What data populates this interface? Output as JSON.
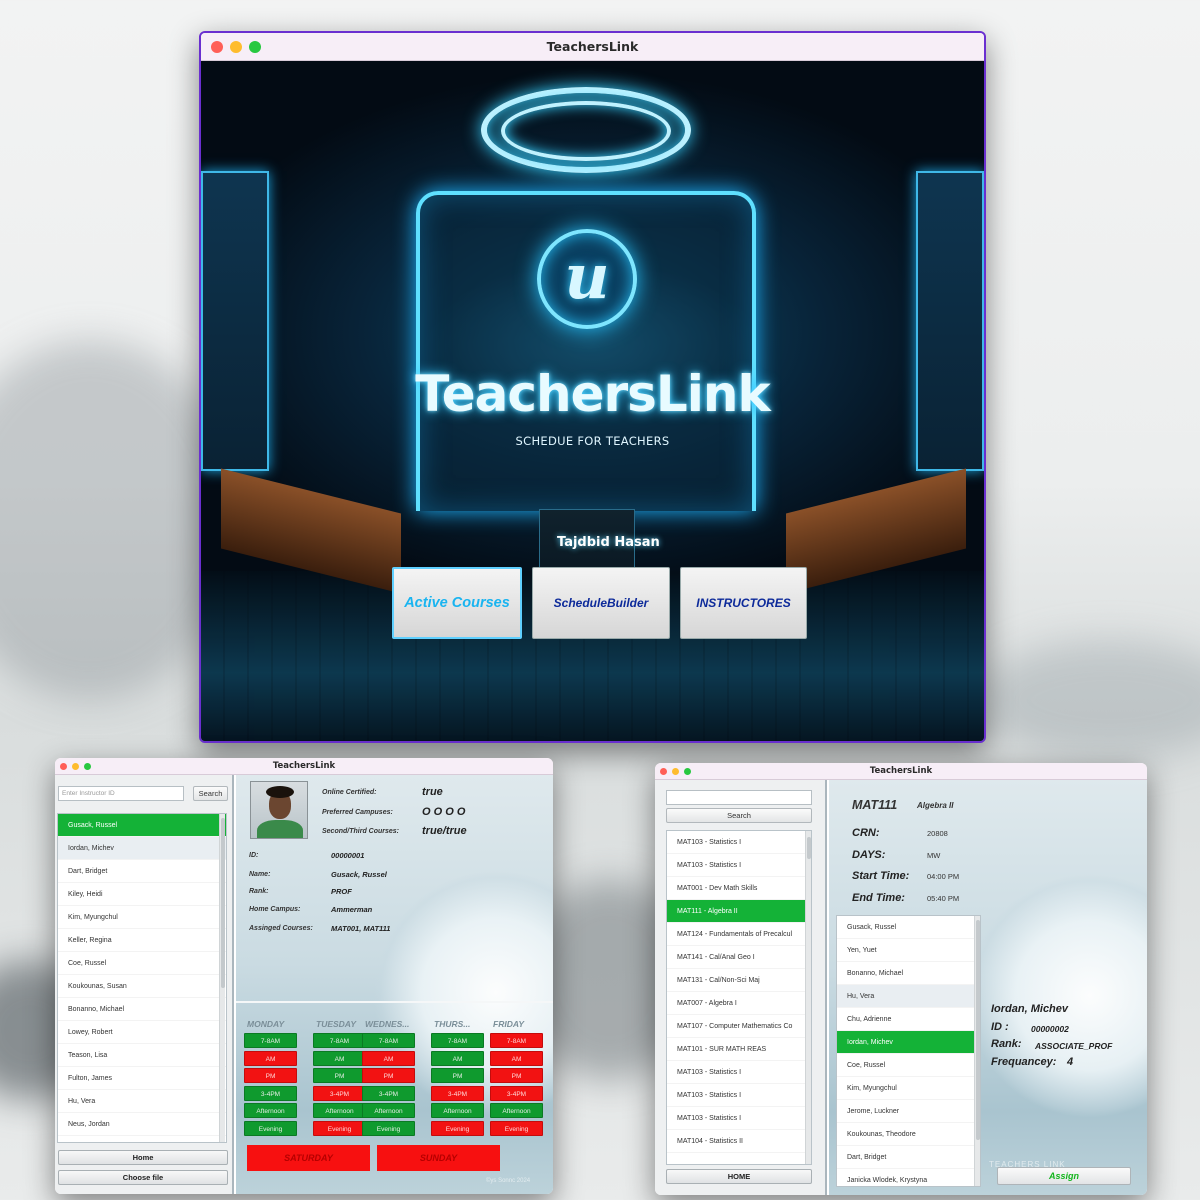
{
  "main_window": {
    "title": "TeachersLink",
    "hero": {
      "logo_letter": "u",
      "app_name": "TeachersLink",
      "tagline": "SCHEDUE FOR TEACHERS",
      "author": "Tajdbid Hasan"
    },
    "buttons": {
      "active_courses": "Active Courses",
      "schedule_builder": "ScheduleBuilder",
      "instructors": "INSTRUCTORES"
    }
  },
  "instructor_window": {
    "title": "TeachersLink",
    "search_placeholder": "Enter Instructor ID",
    "search_button": "Search",
    "instructors": [
      "Gusack, Russel",
      "Iordan, Michev",
      "Dart, Bridget",
      "Kiley, Heidi",
      "Kim, Myungchul",
      "Keller, Regina",
      "Coe, Russel",
      "Koukounas, Susan",
      "Bonanno, Michael",
      "Lowey, Robert",
      "Teason, Lisa",
      "Fulton, James",
      "Hu, Vera",
      "Neus, Jordan"
    ],
    "selected_index": 0,
    "home_button": "Home",
    "choose_file_button": "Choose file",
    "details": {
      "online_certified_label": "Online Certified:",
      "online_certified_value": "true",
      "preferred_campuses_label": "Preferred Campuses:",
      "preferred_campuses_value": "O O O O",
      "second_third_label": "Second/Third Courses:",
      "second_third_value": "true/true",
      "id_label": "ID:",
      "id_value": "00000001",
      "name_label": "Name:",
      "name_value": "Gusack, Russel",
      "rank_label": "Rank:",
      "rank_value": "PROF",
      "home_campus_label": "Home Campus:",
      "home_campus_value": "Ammerman",
      "assigned_courses_label": "Assinged Courses:",
      "assigned_courses_value": "MAT001, MAT111"
    },
    "schedule": {
      "days": [
        "MONDAY",
        "TUESDAY",
        "WEDNES...",
        "THURS...",
        "FRIDAY"
      ],
      "slot_labels": [
        "7-8AM",
        "AM",
        "PM",
        "3-4PM",
        "Afternoon",
        "Evening"
      ],
      "availability": [
        [
          "available",
          "available",
          "available",
          "available",
          "unavailable"
        ],
        [
          "unavailable",
          "available",
          "unavailable",
          "available",
          "unavailable"
        ],
        [
          "unavailable",
          "available",
          "unavailable",
          "available",
          "unavailable"
        ],
        [
          "available",
          "unavailable",
          "available",
          "unavailable",
          "unavailable"
        ],
        [
          "available",
          "available",
          "available",
          "available",
          "available"
        ],
        [
          "available",
          "unavailable",
          "available",
          "unavailable",
          "unavailable"
        ]
      ],
      "saturday": "SATURDAY",
      "sunday": "SUNDAY"
    },
    "watermark": "©ys Sonnc 2024"
  },
  "courses_window": {
    "title": "TeachersLink",
    "search_button": "Search",
    "courses": [
      "MAT103 - Statistics I",
      "MAT103 - Statistics I",
      "MAT001 - Dev Math Skills",
      "MAT111 - Algebra II",
      "MAT124 - Fundamentals of Precalcul",
      "MAT141 - Cal/Anal Geo I",
      "MAT131 - Cal/Non-Sci Maj",
      "MAT007 - Algebra I",
      "MAT107 - Computer Mathematics Co",
      "MAT101 - SUR MATH REAS",
      "MAT103 - Statistics I",
      "MAT103 - Statistics I",
      "MAT103 - Statistics I",
      "MAT104 - Statistics II"
    ],
    "selected_course_index": 3,
    "home_button": "HOME",
    "course": {
      "code": "MAT111",
      "name": "Algebra II",
      "crn_label": "CRN:",
      "crn_value": "20808",
      "days_label": "DAYS:",
      "days_value": "MW",
      "start_label": "Start Time:",
      "start_value": "04:00 PM",
      "end_label": "End Time:",
      "end_value": "05:40 PM"
    },
    "instructors": [
      "Gusack, Russel",
      "Yen, Yuet",
      "Bonanno, Michael",
      "Hu, Vera",
      "Chu, Adrienne",
      "Iordan, Michev",
      "Coe, Russel",
      "Kim, Myungchul",
      "Jerome, Luckner",
      "Koukounas, Theodore",
      "Dart, Bridget",
      "Janicka Wlodek, Krystyna"
    ],
    "selected_instructor_index": 5,
    "selected_instructor": {
      "name": "Iordan, Michev",
      "id_label": "ID :",
      "id_value": "00000002",
      "rank_label": "Rank:",
      "rank_value": "ASSOCIATE_PROF",
      "frequency_label": "Frequancey:",
      "frequency_value": "4"
    },
    "assign_button": "Assign",
    "watermark": "TEACHERS LINK"
  },
  "colors": {
    "available": "#0f9a2e",
    "unavailable": "#f21212",
    "selection": "#14b237",
    "accent_blue": "#19b4f0",
    "window_border": "#6a2fd0"
  }
}
